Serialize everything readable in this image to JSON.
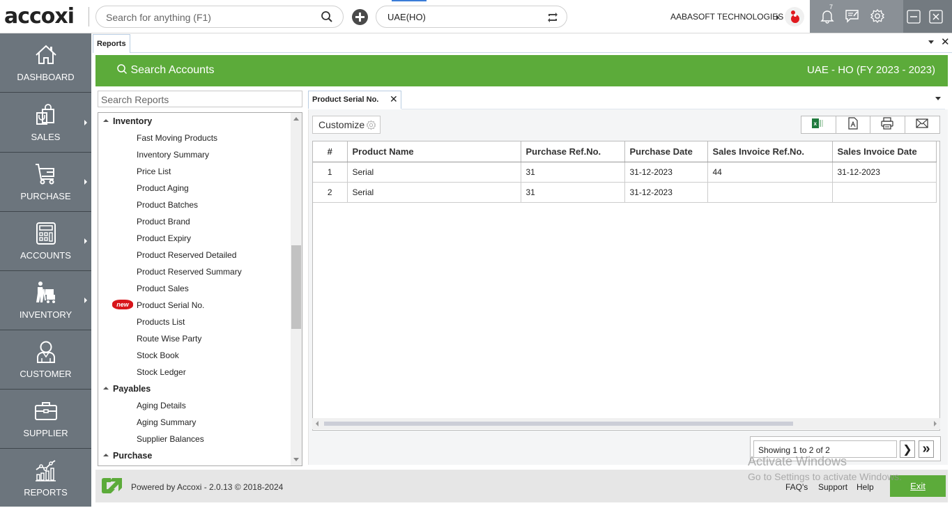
{
  "app": {
    "logo_text": "accoxi",
    "search_placeholder": "Search for anything (F1)",
    "branch": "UAE(HO)",
    "company_name": "AABASOFT TECHNOLOGIES",
    "notification_count": "7"
  },
  "sidebar": {
    "items": [
      {
        "label": "DASHBOARD",
        "icon": "home-icon",
        "has_submenu": false
      },
      {
        "label": "SALES",
        "icon": "shopping-bag-icon",
        "has_submenu": true
      },
      {
        "label": "PURCHASE",
        "icon": "cart-icon",
        "has_submenu": true
      },
      {
        "label": "ACCOUNTS",
        "icon": "calculator-icon",
        "has_submenu": true
      },
      {
        "label": "INVENTORY",
        "icon": "inventory-worker-icon",
        "has_submenu": true
      },
      {
        "label": "CUSTOMER",
        "icon": "user-icon",
        "has_submenu": false
      },
      {
        "label": "SUPPLIER",
        "icon": "briefcase-icon",
        "has_submenu": false
      },
      {
        "label": "REPORTS",
        "icon": "chart-icon",
        "has_submenu": false
      }
    ]
  },
  "main": {
    "doc_tab": "Reports",
    "header": {
      "search_accounts": "Search Accounts",
      "company_fy": "UAE - HO (FY 2023 - 2023)"
    },
    "reports_search_placeholder": "Search Reports",
    "tree": [
      {
        "type": "group",
        "label": "Inventory"
      },
      {
        "type": "item",
        "label": "Fast Moving Products"
      },
      {
        "type": "item",
        "label": "Inventory Summary"
      },
      {
        "type": "item",
        "label": "Price List"
      },
      {
        "type": "item",
        "label": "Product Aging"
      },
      {
        "type": "item",
        "label": "Product Batches"
      },
      {
        "type": "item",
        "label": "Product Brand"
      },
      {
        "type": "item",
        "label": "Product Expiry"
      },
      {
        "type": "item",
        "label": "Product Reserved Detailed"
      },
      {
        "type": "item",
        "label": "Product Reserved Summary"
      },
      {
        "type": "item",
        "label": "Product Sales"
      },
      {
        "type": "item",
        "label": "Product Serial No.",
        "badge": "new"
      },
      {
        "type": "item",
        "label": "Products List"
      },
      {
        "type": "item",
        "label": "Route Wise Party"
      },
      {
        "type": "item",
        "label": "Stock Book"
      },
      {
        "type": "item",
        "label": "Stock Ledger"
      },
      {
        "type": "group",
        "label": "Payables"
      },
      {
        "type": "item",
        "label": "Aging Details"
      },
      {
        "type": "item",
        "label": "Aging Summary"
      },
      {
        "type": "item",
        "label": "Supplier Balances"
      },
      {
        "type": "group",
        "label": "Purchase"
      }
    ],
    "report": {
      "tab_label": "Product Serial No.",
      "customize_label": "Customize",
      "export_buttons": [
        "excel-icon",
        "pdf-icon",
        "print-icon",
        "email-icon"
      ],
      "columns": [
        "#",
        "Product Name",
        "Purchase Ref.No.",
        "Purchase Date",
        "Sales Invoice Ref.No.",
        "Sales Invoice Date"
      ],
      "rows": [
        [
          "1",
          "Serial",
          "31",
          "31-12-2023",
          "44",
          "31-12-2023"
        ],
        [
          "2",
          "Serial",
          "31",
          "31-12-2023",
          "",
          ""
        ]
      ],
      "pager_info": "Showing 1 to 2 of 2",
      "next_label": "❯",
      "last_label": "»"
    }
  },
  "footer": {
    "powered_by": "Powered by Accoxi - 2.0.13 © 2018-2024",
    "links": [
      "FAQ's",
      "Support",
      "Help"
    ],
    "exit_label": "Exit"
  },
  "watermark": {
    "line1": "Activate Windows",
    "line2": "Go to Settings to activate Windows."
  },
  "colors": {
    "accent_green": "#5cab3a",
    "sidebar_bg": "#6c757d",
    "badge_red": "#d8151b"
  }
}
